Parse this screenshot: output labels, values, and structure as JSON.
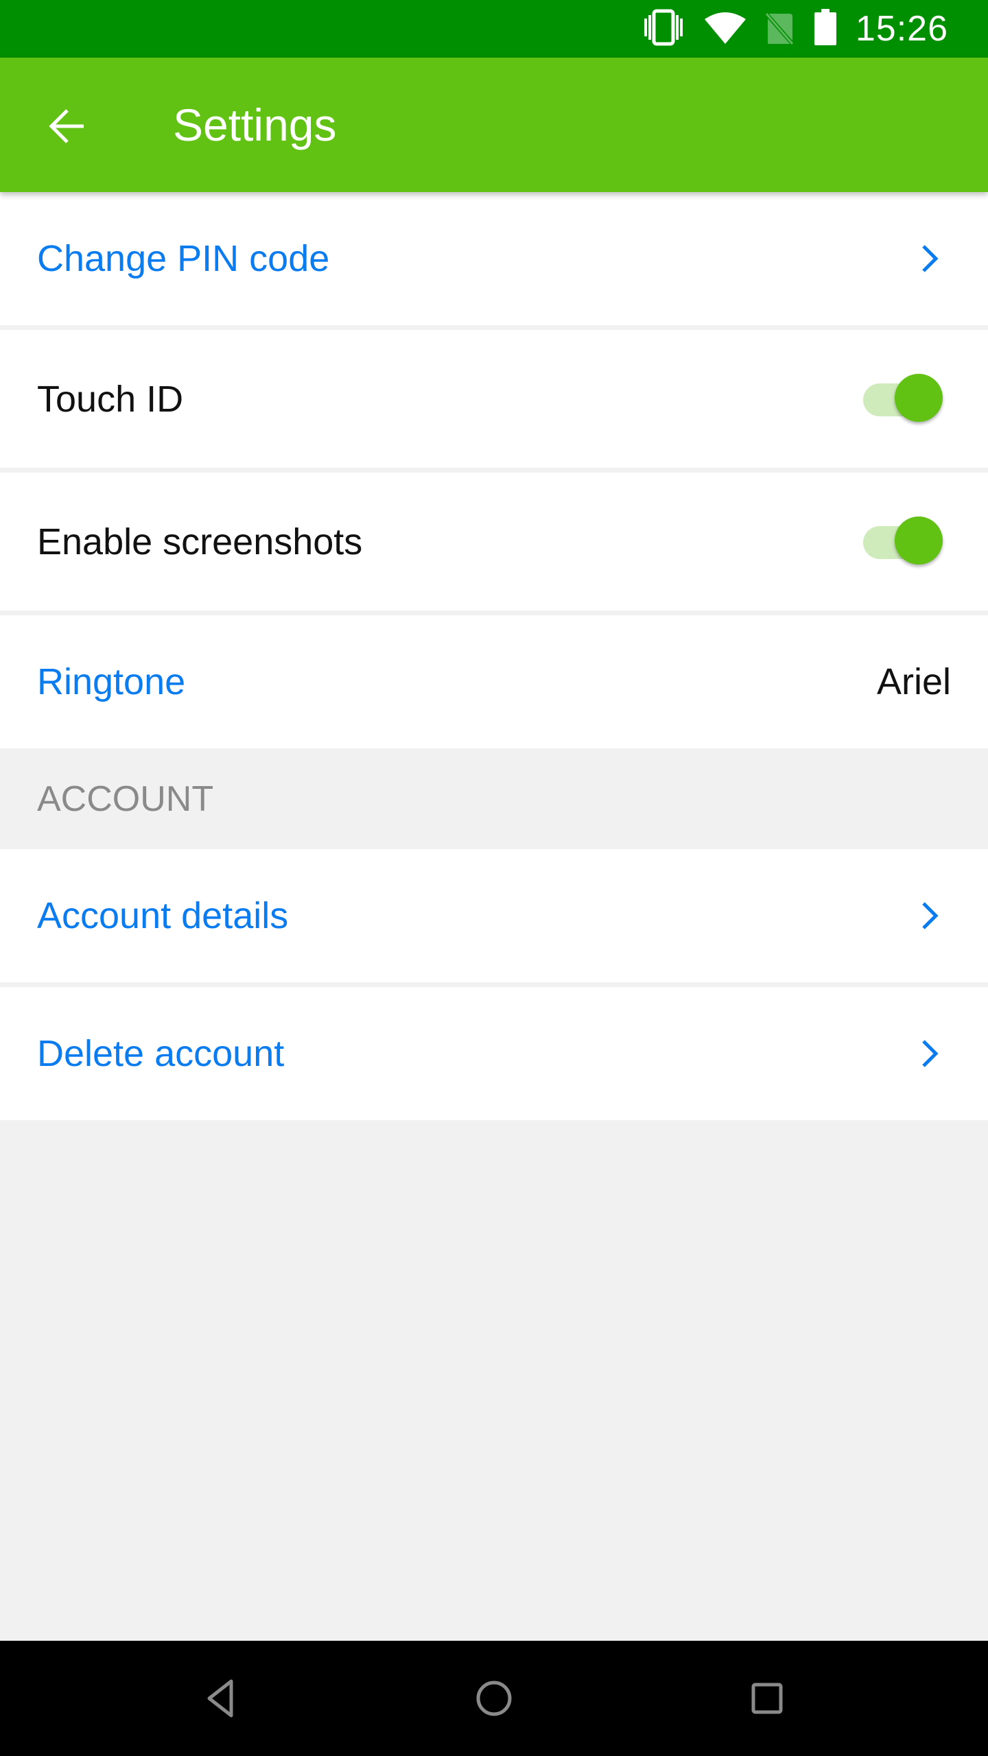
{
  "status_bar": {
    "time": "15:26",
    "icons": [
      "vibrate-icon",
      "wifi-icon",
      "no-sim-icon",
      "battery-icon"
    ]
  },
  "app_bar": {
    "title": "Settings",
    "back_icon": "arrow-left-icon"
  },
  "settings": {
    "change_pin": {
      "label": "Change PIN code"
    },
    "touch_id": {
      "label": "Touch ID",
      "enabled": true
    },
    "screenshots": {
      "label": "Enable screenshots",
      "enabled": true
    },
    "ringtone": {
      "label": "Ringtone",
      "value": "Ariel"
    }
  },
  "account_section": {
    "header": "ACCOUNT",
    "items": [
      {
        "label": "Account details"
      },
      {
        "label": "Delete account"
      }
    ]
  },
  "nav_bar": {
    "buttons": [
      "back",
      "home",
      "recents"
    ]
  },
  "colors": {
    "status_bar": "#008f00",
    "app_bar": "#61c214",
    "link": "#0a7cf0",
    "toggle_on": "#61c214"
  }
}
